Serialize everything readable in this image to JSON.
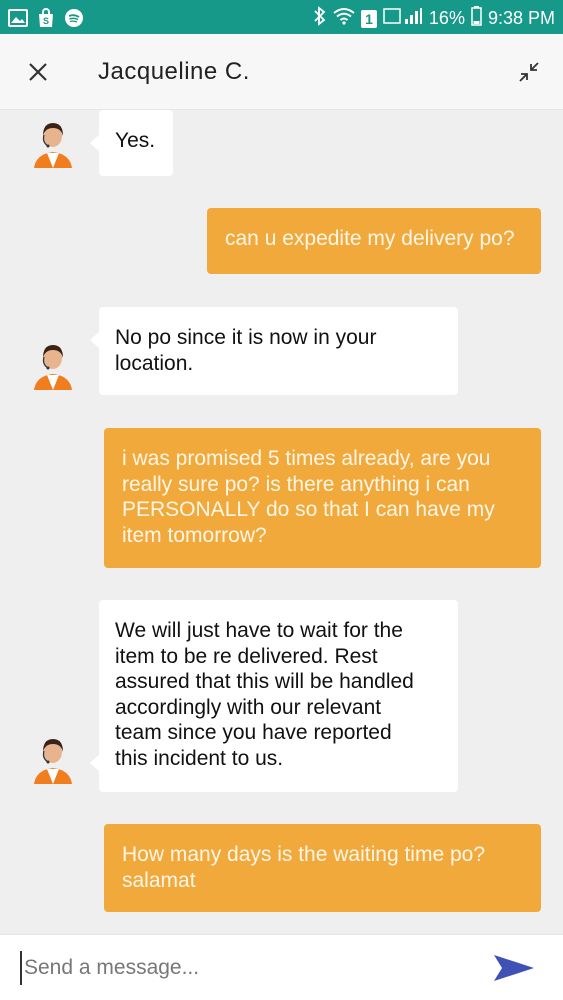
{
  "status_bar": {
    "battery": "16%",
    "time": "9:38 PM",
    "notification_badge": "1",
    "left_icons": [
      "image-icon",
      "shop-icon",
      "spotify-icon"
    ],
    "right_icons": [
      "bluetooth-icon",
      "wifi-icon",
      "signal-icon",
      "battery-icon"
    ],
    "color": "#17998a"
  },
  "header": {
    "agent_name": "Jacqueline  C."
  },
  "messages": [
    {
      "sender": "agent",
      "text": "Yes."
    },
    {
      "sender": "user",
      "text": "can u expedite my delivery po?"
    },
    {
      "sender": "agent",
      "lines": [
        "No po since it is now in your",
        "location."
      ]
    },
    {
      "sender": "user",
      "lines": [
        "i was promised 5 times already, are you",
        "really sure po? is there anything i can",
        "PERSONALLY do so that I can have my",
        "item tomorrow?"
      ]
    },
    {
      "sender": "agent",
      "lines": [
        "We will just have to wait for the",
        "item to be re delivered. Rest",
        "assured that this will be handled",
        "accordingly with our relevant",
        "team since you have reported",
        "this incident to us."
      ]
    },
    {
      "sender": "user",
      "lines": [
        "How many days is the waiting time po?",
        "salamat"
      ]
    }
  ],
  "composer": {
    "placeholder": "Send a message..."
  },
  "colors": {
    "user_bubble": "#f2a93b",
    "agent_bubble": "#ffffff",
    "send_icon": "#3f51b5"
  }
}
